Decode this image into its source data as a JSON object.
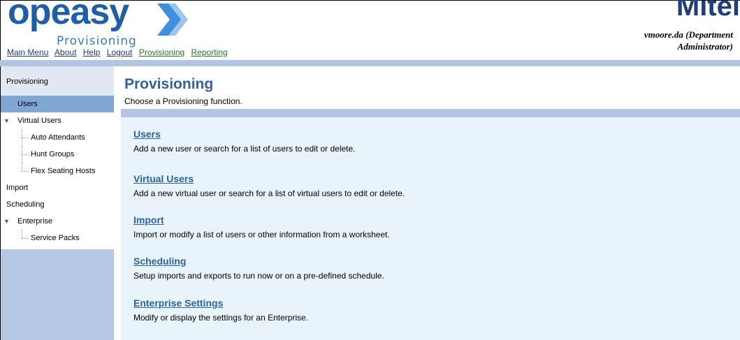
{
  "header": {
    "logo_text": "opeasy",
    "logo_sub": "Provisioning",
    "brand_right": "Mitel",
    "user_line1": "vmoore.da (Department",
    "user_line2": "Administrator)",
    "nav": [
      {
        "label": "Main Menu",
        "color": "blue"
      },
      {
        "label": "About",
        "color": "blue"
      },
      {
        "label": "Help",
        "color": "blue"
      },
      {
        "label": "Logout",
        "color": "blue"
      },
      {
        "label": "Provisioning",
        "color": "green"
      },
      {
        "label": "Reporting",
        "color": "green"
      }
    ]
  },
  "sidebar": {
    "heading": "Provisioning",
    "items": [
      {
        "label": "Users"
      },
      {
        "label": "Virtual Users"
      },
      {
        "label": "Auto Attendants"
      },
      {
        "label": "Hunt Groups"
      },
      {
        "label": "Flex Seating Hosts"
      },
      {
        "label": "Import"
      },
      {
        "label": "Scheduling"
      },
      {
        "label": "Enterprise"
      },
      {
        "label": "Service Packs"
      }
    ]
  },
  "main": {
    "title": "Provisioning",
    "subtitle": "Choose a Provisioning function.",
    "entries": [
      {
        "title": "Users",
        "desc": "Add a new user or search for a list of users to edit or delete."
      },
      {
        "title": "Virtual Users",
        "desc": "Add a new virtual user or search for a list of virtual users to edit or delete."
      },
      {
        "title": "Import",
        "desc": "Import or modify a list of users or other information from a worksheet."
      },
      {
        "title": "Scheduling",
        "desc": "Setup imports and exports to run now or on a pre-defined schedule."
      },
      {
        "title": "Enterprise Settings",
        "desc": "Modify or display the settings for an Enterprise."
      }
    ]
  },
  "colors": {
    "accent": "#2d63a2",
    "band": "#b2c6e4",
    "content_bg": "#e8f3fc",
    "sidebar_active": "#7fa7d3"
  }
}
